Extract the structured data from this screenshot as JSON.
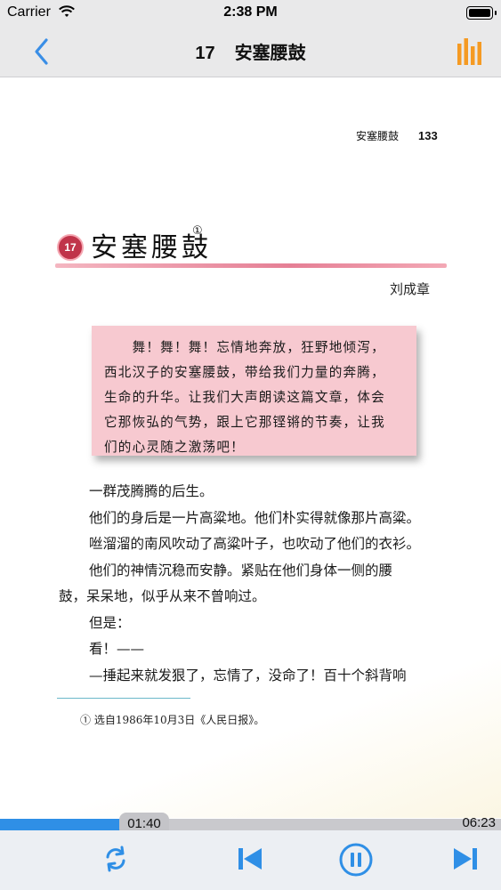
{
  "status_bar": {
    "carrier": "Carrier",
    "time": "2:38 PM",
    "battery_level": 1.0
  },
  "nav": {
    "lesson_number": "17",
    "title": "安塞腰鼓",
    "back_icon": "chevron-left-icon",
    "right_icon": "bar-chart-icon",
    "accent_color": "#f59a23",
    "back_color": "#3a8ee6"
  },
  "page": {
    "running_head": "安塞腰鼓",
    "page_number": "133",
    "lesson_badge": "17",
    "lesson_title": "安塞腰鼓",
    "footnote_marker": "①",
    "author": "刘成章",
    "intro_lines": [
      "　　舞！舞！舞！忘情地奔放，狂野地倾泻，",
      "西北汉子的安塞腰鼓，带给我们力量的奔腾，",
      "生命的升华。让我们大声朗读这篇文章，体会",
      "它那恢弘的气势，跟上它那铿锵的节奏，让我",
      "们的心灵随之激荡吧！"
    ],
    "body_lines": [
      "一群茂腾腾的后生。",
      "他们的身后是一片高粱地。他们朴实得就像那片高粱。",
      "咝溜溜的南风吹动了高粱叶子，也吹动了他们的衣衫。",
      "他们的神情沉稳而安静。紧贴在他们身体一侧的腰",
      "鼓，呆呆地，似乎从来不曾响过。",
      "但是：",
      "看！——",
      "—捶起来就发狠了，忘情了，没命了！百十个斜背响"
    ],
    "footnote": "① 选自1986年10月3日《人民日报》。"
  },
  "player": {
    "current_time": "01:40",
    "total_time": "06:23",
    "progress_fraction": 0.261,
    "progress_color": "#2f8fe6",
    "icons": [
      "repeat-icon",
      "skip-previous-icon",
      "pause-icon",
      "skip-next-icon"
    ],
    "icon_color": "#2f8fe6"
  }
}
